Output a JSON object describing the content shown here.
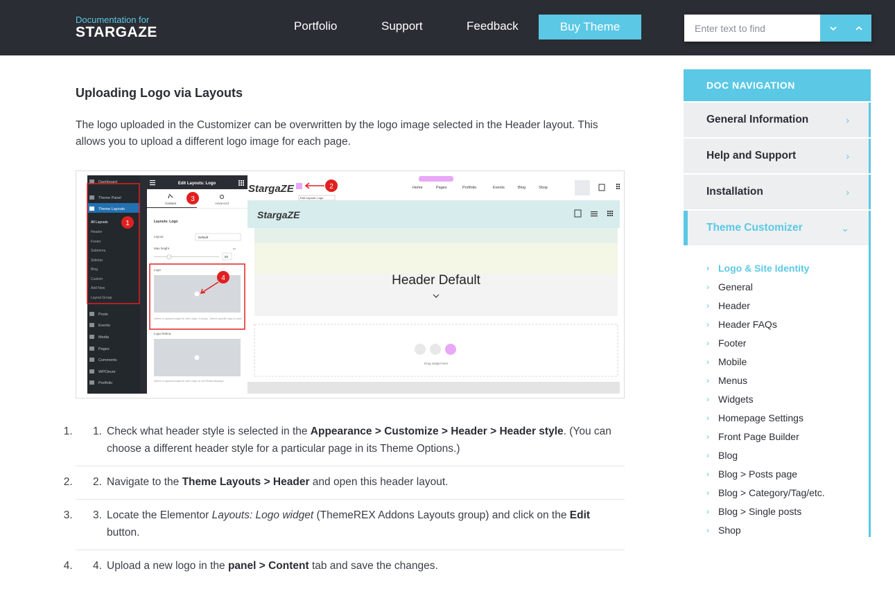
{
  "header": {
    "brand_small": "Documentation for",
    "brand_main": "STARGAZE",
    "nav": [
      {
        "label": "Portfolio"
      },
      {
        "label": "Support"
      },
      {
        "label": "Feedback"
      }
    ],
    "buy_label": "Buy Theme",
    "search_placeholder": "Enter text to find"
  },
  "content": {
    "title": "Uploading Logo via Layouts",
    "intro": "The logo uploaded in the Customizer can be overwritten by the logo image selected in the Header layout. This allows you to upload a different logo image for each page.",
    "screenshot": {
      "admin_menu": [
        "Dashboard",
        "Theme Panel",
        "Theme Layouts"
      ],
      "admin_sub": [
        "All Layouts",
        "Header",
        "Footer",
        "Submenu",
        "Sidebar",
        "Blog",
        "Custom",
        "Add New",
        "Layout Group"
      ],
      "admin_menu2": [
        "Posts",
        "Events",
        "Media",
        "Pages",
        "Comments",
        "WPClever",
        "Portfolio"
      ],
      "panel_title": "Edit Layouts: Logo",
      "tab_content": "Content",
      "tab_advanced": "Advanced",
      "section_label": "Layouts: Logo",
      "layout_label": "Layout",
      "layout_value": "Default",
      "maxheight_label": "Max height",
      "maxheight_unit": "px",
      "maxheight_value": "50",
      "logo_label": "Logo",
      "logo_help": "Select or upload image for site's logo, if empty - theme-specific logo is used",
      "logo_retina_label": "Logo Retina",
      "logo_retina_help": "Select or upload image for site's logo on the Retina displays",
      "site_logo": "StargaZE",
      "tooltip": "Edit Layouts: Logo",
      "site_nav": [
        "Home",
        "Pages",
        "Portfolio",
        "Events",
        "Blog",
        "Shop"
      ],
      "canvas_heading": "Header Default",
      "drag_text": "Drag widget here",
      "badges": [
        "1",
        "2",
        "3",
        "4"
      ]
    },
    "steps": [
      {
        "num": "1.",
        "parts": [
          "Check what header style is selected in the ",
          "Appearance > Customize > Header > Header style",
          ". (You can choose a different header style for a particular page in its Theme Options.)"
        ]
      },
      {
        "num": "2.",
        "parts": [
          "Navigate to the ",
          "Theme Layouts > Header",
          " and open this header layout."
        ]
      },
      {
        "num": "3.",
        "parts": [
          "Locate the Elementor ",
          "Layouts: Logo widget",
          " (ThemeREX Addons Layouts group) and click on the ",
          "Edit",
          " button."
        ]
      },
      {
        "num": "4.",
        "parts": [
          "Upload a new logo in the ",
          "panel > Content",
          " tab and save the changes."
        ]
      }
    ]
  },
  "sidebar": {
    "heading": "DOC NAVIGATION",
    "items": [
      {
        "label": "General Information"
      },
      {
        "label": "Help and Support"
      },
      {
        "label": "Installation"
      },
      {
        "label": "Theme Customizer"
      }
    ],
    "sub_items": [
      {
        "label": "Logo & Site Identity"
      },
      {
        "label": "General"
      },
      {
        "label": "Header"
      },
      {
        "label": "Header FAQs"
      },
      {
        "label": "Footer"
      },
      {
        "label": "Mobile"
      },
      {
        "label": "Menus"
      },
      {
        "label": "Widgets"
      },
      {
        "label": "Homepage Settings"
      },
      {
        "label": "Front Page Builder"
      },
      {
        "label": "Blog"
      },
      {
        "label": "Blog > Posts page"
      },
      {
        "label": "Blog > Category/Tag/etc."
      },
      {
        "label": "Blog > Single posts"
      },
      {
        "label": "Shop"
      }
    ]
  },
  "colors": {
    "accent": "#5bc8e5",
    "topbar": "#2a2d33",
    "marker": "#e02020"
  }
}
